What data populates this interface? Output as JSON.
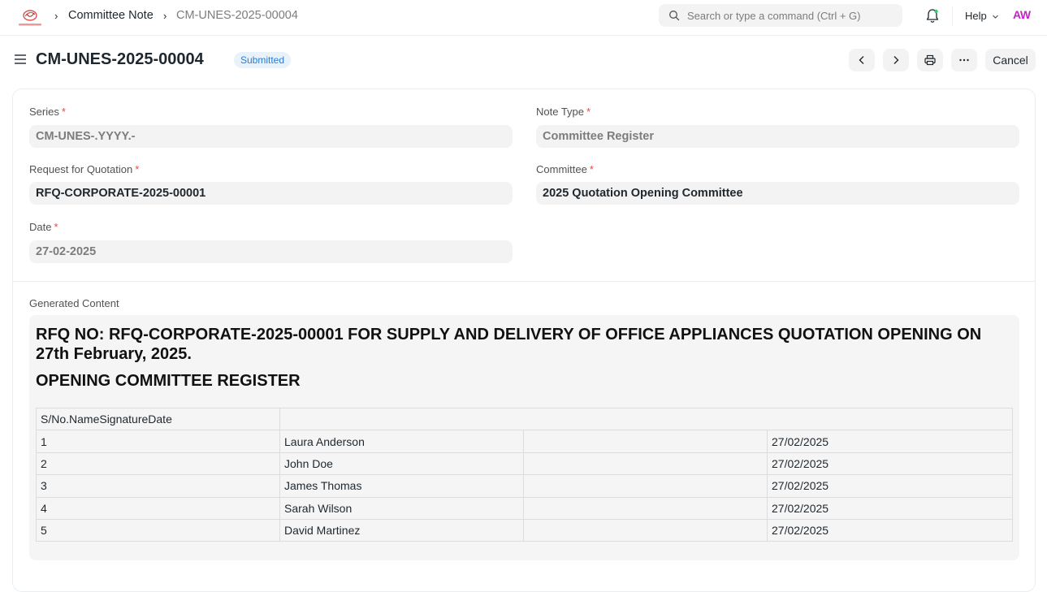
{
  "navbar": {
    "breadcrumbs": [
      "Committee Note",
      "CM-UNES-2025-00004"
    ],
    "search_placeholder": "Search or type a command (Ctrl + G)",
    "help_label": "Help",
    "avatar_initials": "AW"
  },
  "header": {
    "title": "CM-UNES-2025-00004",
    "status": "Submitted",
    "cancel_label": "Cancel"
  },
  "form": {
    "series": {
      "label": "Series",
      "value": "CM-UNES-.YYYY.-"
    },
    "note_type": {
      "label": "Note Type",
      "value": "Committee Register"
    },
    "rfq": {
      "label": "Request for Quotation",
      "value": "RFQ-CORPORATE-2025-00001"
    },
    "committee": {
      "label": "Committee",
      "value": "2025 Quotation Opening Committee"
    },
    "date": {
      "label": "Date",
      "value": "27-02-2025"
    },
    "required_mark": "*"
  },
  "generated": {
    "label": "Generated Content",
    "heading": "RFQ NO: RFQ-CORPORATE-2025-00001 FOR SUPPLY AND DELIVERY OF OFFICE APPLIANCES QUOTATION OPENING ON 27th February, 2025.",
    "subheading": "OPENING COMMITTEE REGISTER",
    "table_header": "S/No.NameSignatureDate",
    "rows": [
      {
        "no": "1",
        "name": "Laura Anderson",
        "signature": "",
        "date": "27/02/2025"
      },
      {
        "no": "2",
        "name": "John Doe",
        "signature": "",
        "date": "27/02/2025"
      },
      {
        "no": "3",
        "name": "James Thomas",
        "signature": "",
        "date": "27/02/2025"
      },
      {
        "no": "4",
        "name": "Sarah Wilson",
        "signature": "",
        "date": "27/02/2025"
      },
      {
        "no": "5",
        "name": "David Martinez",
        "signature": "",
        "date": "27/02/2025"
      }
    ]
  },
  "colors": {
    "status_badge_bg": "#e8f2fb",
    "status_badge_text": "#2b7cd3",
    "required": "#e24c4c",
    "avatar": "#c225c7"
  },
  "icons": [
    "app-logo-icon",
    "chevron-right-icon",
    "search-icon",
    "bell-icon",
    "chevron-down-icon",
    "menu-icon",
    "chevron-left-icon",
    "printer-icon",
    "more-icon"
  ]
}
